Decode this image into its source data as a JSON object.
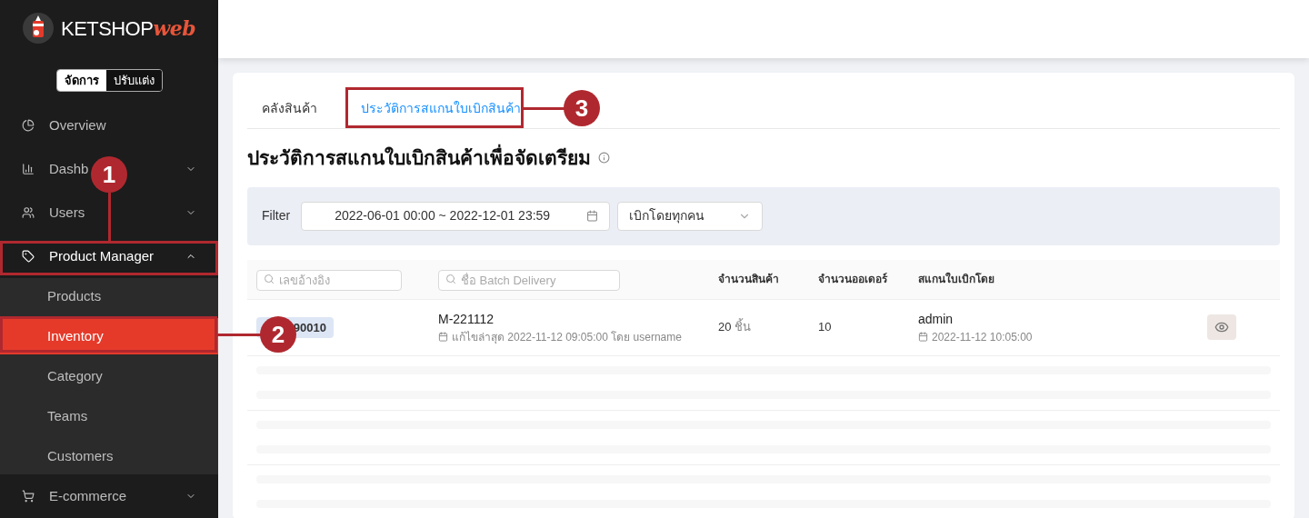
{
  "brand": {
    "name": "KETSHOP",
    "suffix": "web"
  },
  "mode_switch": [
    {
      "label": "จัดการ",
      "selected": true
    },
    {
      "label": "ปรับแต่ง",
      "selected": false
    }
  ],
  "sidebar": {
    "items": [
      {
        "label": "Overview"
      },
      {
        "label": "Dashb",
        "expanded": false
      },
      {
        "label": "Users",
        "expanded": false
      },
      {
        "label": "Product Manager",
        "expanded": true,
        "children": [
          {
            "label": "Products",
            "selected": false
          },
          {
            "label": "Inventory",
            "selected": true
          },
          {
            "label": "Category",
            "selected": false
          },
          {
            "label": "Teams",
            "selected": false
          },
          {
            "label": "Customers",
            "selected": false
          }
        ]
      },
      {
        "label": "E-commerce",
        "expanded": false
      }
    ]
  },
  "tabs": [
    {
      "label": "คลังสินค้า",
      "selected": false
    },
    {
      "label": "ประวัติการสแกนใบเบิกสินค้า",
      "selected": true
    }
  ],
  "heading": "ประวัติการสแกนใบเบิกสินค้าเพื่อจัดเตรียม",
  "filter": {
    "label": "Filter",
    "date_range": "2022-06-01 00:00 ~ 2022-12-01 23:59",
    "picker": "เบิกโดยทุกคน"
  },
  "table": {
    "search_fields": [
      {
        "placeholder": "เลขอ้างอิง"
      },
      {
        "placeholder": "ชื่อ Batch Delivery"
      }
    ],
    "columns": [
      "จำนวนสินค้า",
      "จำนวนออเดอร์",
      "สแกนใบเบิกโดย"
    ],
    "rows": [
      {
        "ref": "90010",
        "name": "M-221112",
        "edited": "แก้ไขล่าสุด 2022-11-12 09:05:00 โดย username",
        "quantity": "20",
        "unit": "ชิ้น",
        "orders": "10",
        "scanned_by": "admin",
        "scanned_at": "2022-11-12 10:05:00"
      }
    ],
    "loading_rows": [
      {
        "kind": "skeleton"
      },
      {
        "kind": "skeleton"
      },
      {
        "kind": "skeleton"
      }
    ]
  },
  "callouts": [
    {
      "number": "1"
    },
    {
      "number": "2"
    },
    {
      "number": "3"
    }
  ]
}
